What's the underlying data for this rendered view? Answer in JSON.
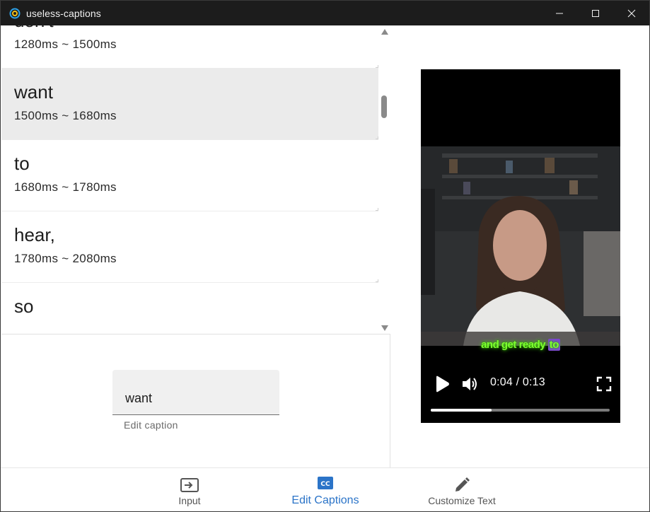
{
  "window": {
    "title": "useless-captions"
  },
  "captions": [
    {
      "word": "don't",
      "time": "1280ms ~ 1500ms"
    },
    {
      "word": "want",
      "time": "1500ms ~ 1680ms"
    },
    {
      "word": "to",
      "time": "1680ms ~ 1780ms"
    },
    {
      "word": "hear,",
      "time": "1780ms ~ 2080ms"
    },
    {
      "word": "so",
      "time": ""
    }
  ],
  "selected_index": 1,
  "editor": {
    "value": "want",
    "helper": "Edit caption"
  },
  "video": {
    "caption_text": "and get ready",
    "caption_highlight": "to",
    "time_display": "0:04 / 0:13",
    "progress_fraction": 0.34
  },
  "nav": {
    "items": [
      {
        "label": "Input",
        "icon": "input-icon"
      },
      {
        "label": "Edit Captions",
        "icon": "closed-captions-icon"
      },
      {
        "label": "Customize Text",
        "icon": "pencil-icon"
      }
    ],
    "active_index": 1
  },
  "colors": {
    "accent": "#2b74c8",
    "caption_green": "#7dff2f",
    "caption_highlight": "#7d3fd6"
  }
}
